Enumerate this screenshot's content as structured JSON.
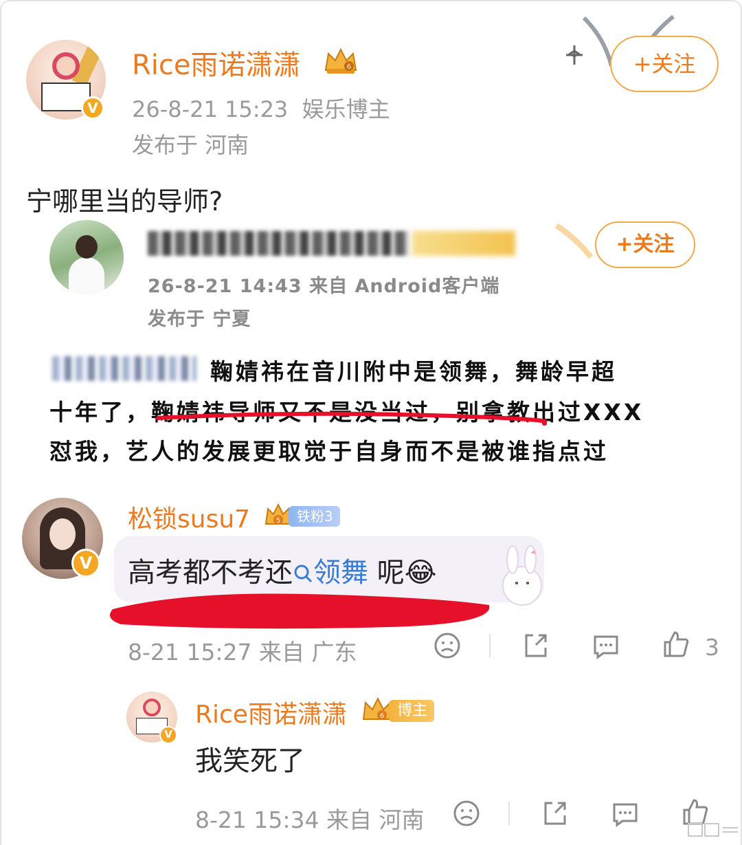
{
  "post": {
    "author": "Rice雨诺潇潇",
    "time": "26-8-21 15:23",
    "role": "娱乐博主",
    "location": "发布于 河南",
    "follow_label": "+关注",
    "text": "宁哪里当的导师?"
  },
  "embedded": {
    "time_source": "26-8-21 14:43  来自 Android客户端",
    "location": "发布于 宁夏",
    "follow_label": "+关注",
    "line1": "鞠婧祎在音川附中是领舞，舞龄早超",
    "line2": "十年了，鞠婧祎导师又不是没当过，别拿教出过XXX",
    "line3": "怼我，艺人的发展更取觉于自身而不是被谁指点过"
  },
  "comment": {
    "author": "松锁susu7",
    "fan_badge": "铁粉3",
    "text_before": "高考都不考还",
    "link_text": "领舞",
    "text_after": " 呢",
    "emoji": "😂",
    "time_location": "8-21 15:27  来自 广东",
    "like_count": "3"
  },
  "reply": {
    "author": "Rice雨诺潇潇",
    "badge": "博主",
    "text": "我笑死了",
    "time_location": "8-21 15:34  来自 河南"
  },
  "icons": {
    "verify": "V",
    "dislike": "sad-face-icon",
    "share": "share-icon",
    "comment": "comment-icon",
    "like": "thumbs-up-icon"
  },
  "colors": {
    "username": "#ec7a1e",
    "link": "#3a7bd5",
    "meta": "#9a9a9a",
    "highlight_mark": "#e6102a"
  }
}
